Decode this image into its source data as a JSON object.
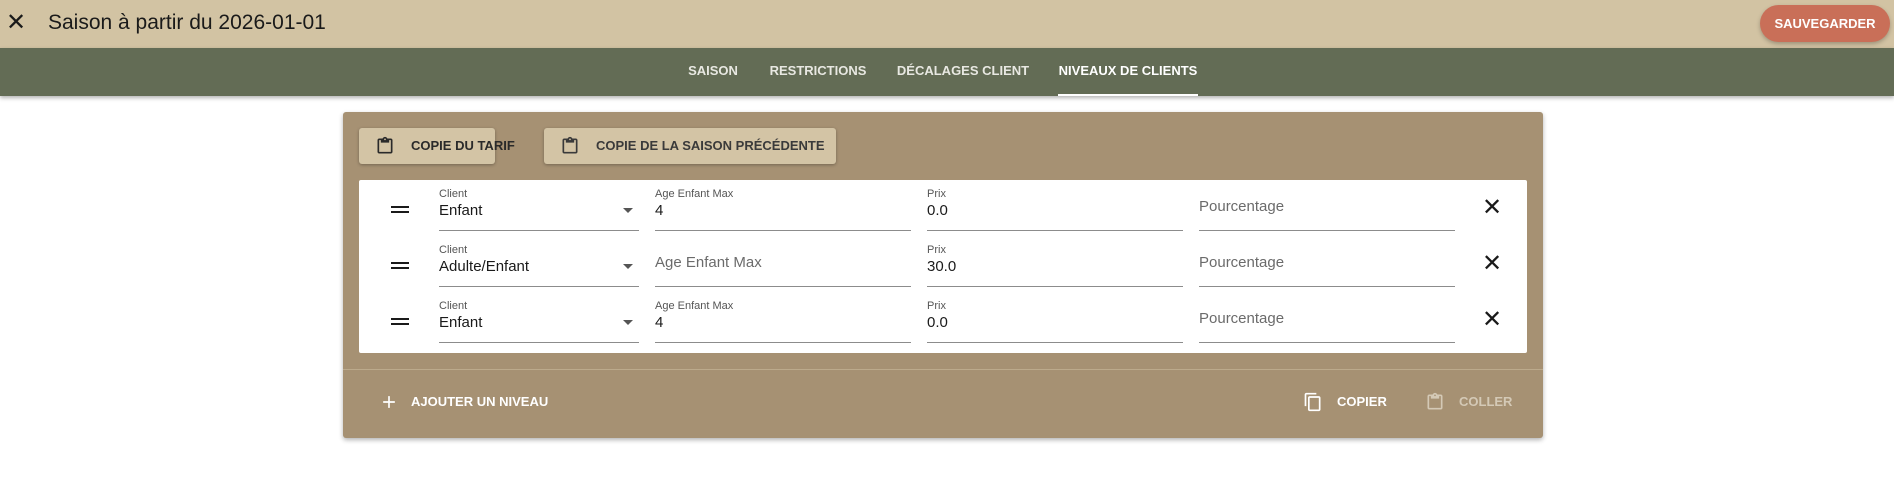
{
  "header": {
    "title": "Saison à partir du 2026-01-01",
    "close_icon": "close-icon",
    "save_label": "SAUVEGARDER"
  },
  "tabs": [
    {
      "label": "SAISON",
      "active": false
    },
    {
      "label": "RESTRICTIONS",
      "active": false
    },
    {
      "label": "DÉCALAGES CLIENT",
      "active": false
    },
    {
      "label": "NIVEAUX DE CLIENTS",
      "active": true
    }
  ],
  "copy_buttons": {
    "tariff": {
      "label": "COPIE DU TARIF",
      "icon": "clipboard-icon"
    },
    "previous_season": {
      "label": "COPIE DE LA SAISON PRÉCÉDENTE",
      "icon": "clipboard-icon"
    }
  },
  "levels": [
    {
      "client_label": "Client",
      "client_value": "Enfant",
      "age_label": "Age Enfant Max",
      "age_value": "4",
      "age_placeholder": "",
      "price_label": "Prix",
      "price_value": "0.0",
      "percent_placeholder": "Pourcentage"
    },
    {
      "client_label": "Client",
      "client_value": "Adulte/Enfant",
      "age_label": "",
      "age_value": "",
      "age_placeholder": "Age Enfant Max",
      "price_label": "Prix",
      "price_value": "30.0",
      "percent_placeholder": "Pourcentage"
    },
    {
      "client_label": "Client",
      "client_value": "Enfant",
      "age_label": "Age Enfant Max",
      "age_value": "4",
      "age_placeholder": "",
      "price_label": "Prix",
      "price_value": "0.0",
      "percent_placeholder": "Pourcentage"
    }
  ],
  "footer": {
    "add_level_label": "AJOUTER UN NIVEAU",
    "copy_label": "COPIER",
    "paste_label": "COLLER",
    "paste_disabled": true
  },
  "colors": {
    "topbar": "#d2c3a3",
    "tabbar": "#636c55",
    "card": "#a69173",
    "save_button": "#c96f58"
  }
}
